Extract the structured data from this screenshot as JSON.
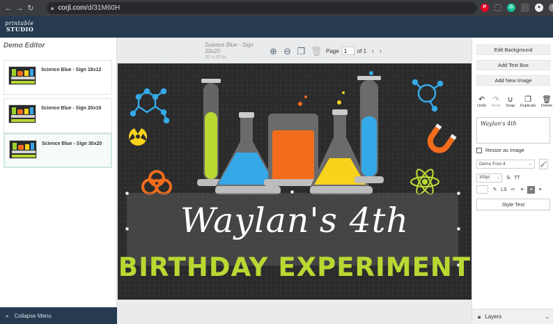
{
  "browser": {
    "url_host": "corjl.com",
    "url_path": "/d/31M60H",
    "extensions": [
      {
        "name": "pinterest-icon",
        "letter": "P",
        "color": "#e60023"
      },
      {
        "name": "grammarly-icon",
        "letter": "G",
        "color": "#15c39a"
      }
    ]
  },
  "brand": {
    "line1": "printable",
    "line2": "STUDIO"
  },
  "left_panel": {
    "title": "Demo Editor",
    "templates": [
      {
        "name": "Science Blue - Sign 18x12",
        "selected": false
      },
      {
        "name": "Science Blue - Sign 20x16",
        "selected": false
      },
      {
        "name": "Science Blue - Sign 30x20",
        "selected": true
      }
    ],
    "collapse_label": "Collapse Menu"
  },
  "toolbar": {
    "doc_title": "Science Blue - Sign 30x20",
    "doc_size": "30 x 20 in",
    "page_label": "Page",
    "page_value": "1",
    "page_of": "of 1"
  },
  "design": {
    "name_line": "Waylan's 4th",
    "subtitle": "BIRTHDAY EXPERIMENT",
    "colors": {
      "lime": "#b9d832",
      "blue": "#35a9e8",
      "orange": "#f36c1c",
      "yellow": "#f9d21c"
    }
  },
  "right_panel": {
    "edit_background": "Edit Background",
    "add_text_box": "Add Text Box",
    "add_new_image": "Add New Image",
    "actions": [
      {
        "label": "Undo",
        "icon": "undo-icon",
        "enabled": true
      },
      {
        "label": "Redo",
        "icon": "redo-icon",
        "enabled": false
      },
      {
        "label": "Snap",
        "icon": "snap-icon",
        "enabled": true
      },
      {
        "label": "Duplicate",
        "icon": "duplicate-icon",
        "enabled": true
      },
      {
        "label": "Delete",
        "icon": "delete-icon",
        "enabled": true
      }
    ],
    "text_value": "Waylan's 4th",
    "resize_as_image": "Resize as Image",
    "font": "Demo Font 4",
    "font_size": "300pt",
    "style_text": "Style Text",
    "layers": "Layers"
  }
}
